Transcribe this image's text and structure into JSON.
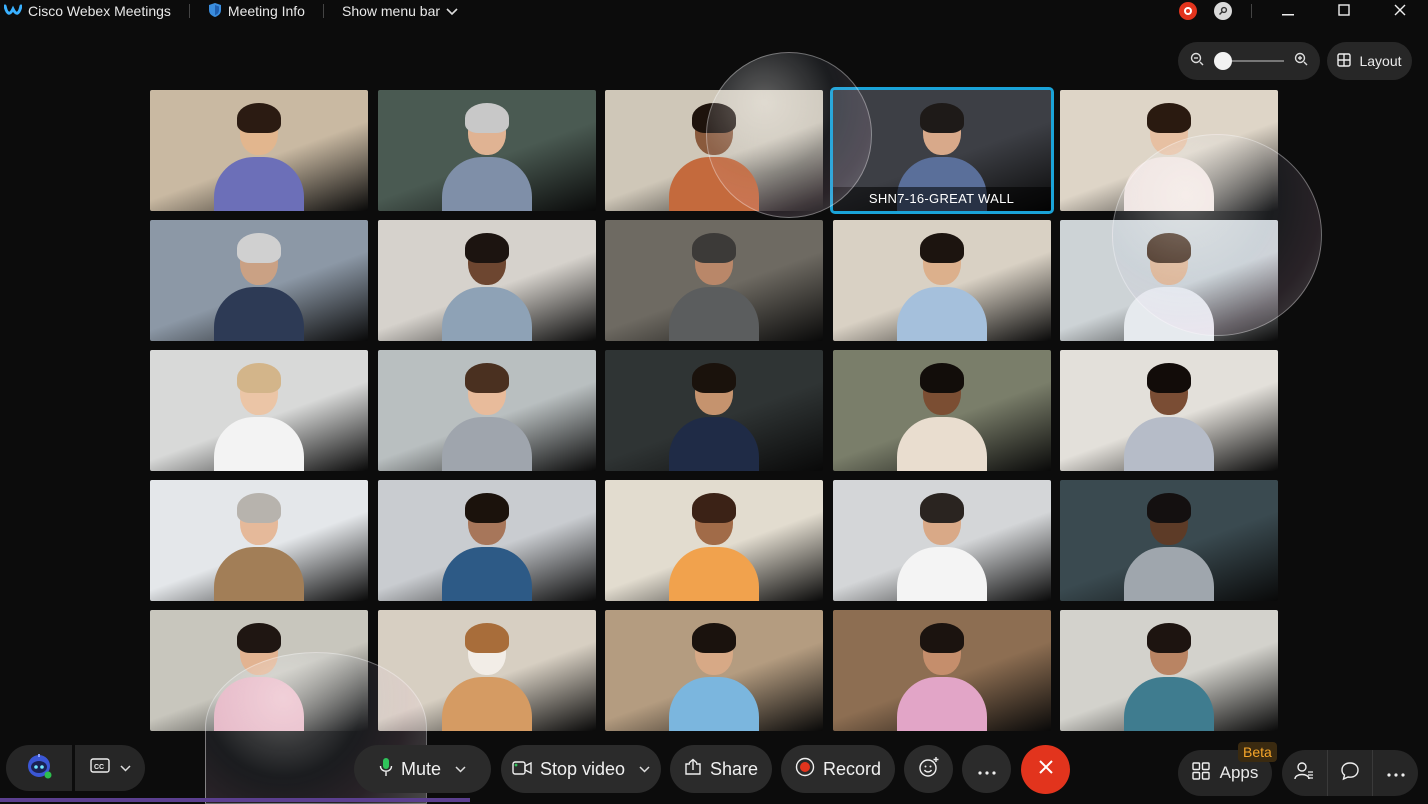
{
  "titlebar": {
    "app_name": "Cisco Webex Meetings",
    "meeting_info": "Meeting Info",
    "show_menu_bar": "Show menu bar"
  },
  "top_controls": {
    "layout_label": "Layout",
    "zoom_level": 0.0
  },
  "tiles": [
    {
      "scene": "#c9b9a2",
      "shirt": "#6c6fb8",
      "skin": "#e2b68e",
      "hair": "#2b1b12"
    },
    {
      "scene": "#4a5a52",
      "shirt": "#7f8fa8",
      "skin": "#e0b393",
      "hair": "#c8c8c8"
    },
    {
      "scene": "#cfc7b8",
      "shirt": "#c46a3d",
      "skin": "#8a5a3c",
      "hair": "#1e130c"
    },
    {
      "scene": "#3d3f45",
      "shirt": "#5a6f9a",
      "skin": "#d8a98a",
      "hair": "#1e1a18",
      "label": "SHN7-16-GREAT WALL",
      "active": true
    },
    {
      "scene": "#ded5c7",
      "shirt": "#f1e4df",
      "skin": "#e7c0a2",
      "hair": "#2a1a10"
    },
    {
      "scene": "#8c98a6",
      "shirt": "#2d3a55",
      "skin": "#caa184",
      "hair": "#d0d0d0"
    },
    {
      "scene": "#d6d2cc",
      "shirt": "#8ea2b6",
      "skin": "#6d4630",
      "hair": "#1c1410"
    },
    {
      "scene": "#6e6a62",
      "shirt": "#5b5d5e",
      "skin": "#b98769",
      "hair": "#3c3a38"
    },
    {
      "scene": "#d9d1c4",
      "shirt": "#a5c0dc",
      "skin": "#dcb08c",
      "hair": "#1c140f"
    },
    {
      "scene": "#cdd3d6",
      "shirt": "#e6eaee",
      "skin": "#e0b796",
      "hair": "#4a3221"
    },
    {
      "scene": "#d8d9d8",
      "shirt": "#f3f3f3",
      "skin": "#ebc5a6",
      "hair": "#d3b58a"
    },
    {
      "scene": "#b9bfc0",
      "shirt": "#9fa5ad",
      "skin": "#e8bb9b",
      "hair": "#4a3020"
    },
    {
      "scene": "#2f3434",
      "shirt": "#1f2b46",
      "skin": "#c5936e",
      "hair": "#1a120c"
    },
    {
      "scene": "#7a7e6a",
      "shirt": "#e9ddcf",
      "skin": "#7b4e33",
      "hair": "#120d0a"
    },
    {
      "scene": "#e3e0da",
      "shirt": "#b6bcc8",
      "skin": "#7a4d34",
      "hair": "#120c09"
    },
    {
      "scene": "#e4e7ea",
      "shirt": "#a27e57",
      "skin": "#e5b99a",
      "hair": "#b7b3ad"
    },
    {
      "scene": "#c9ccd0",
      "shirt": "#2d5a86",
      "skin": "#a7765a",
      "hair": "#1b120c"
    },
    {
      "scene": "#e2dccf",
      "shirt": "#f1a24d",
      "skin": "#a16b48",
      "hair": "#3b2216"
    },
    {
      "scene": "#d4d6d8",
      "shirt": "#f4f4f4",
      "skin": "#d9a987",
      "hair": "#2a2420"
    },
    {
      "scene": "#3a4a50",
      "shirt": "#9fa6ad",
      "skin": "#5d3b27",
      "hair": "#141010"
    },
    {
      "scene": "#c8c6bd",
      "shirt": "#e9b7c4",
      "skin": "#e2b391",
      "hair": "#1f1612"
    },
    {
      "scene": "#d7cfc2",
      "shirt": "#d59b63",
      "skin": "#f2ede7",
      "hair": "#a86d3a"
    },
    {
      "scene": "#b49c80",
      "shirt": "#7bb6de",
      "skin": "#d7a986",
      "hair": "#1a120d"
    },
    {
      "scene": "#8d6e52",
      "shirt": "#e2a5c7",
      "skin": "#c58e6c",
      "hair": "#1b130f"
    },
    {
      "scene": "#d3d2cc",
      "shirt": "#3f7c8f",
      "skin": "#b98463",
      "hair": "#1d1410"
    }
  ],
  "toolbar": {
    "mute_label": "Mute",
    "stop_video_label": "Stop video",
    "share_label": "Share",
    "record_label": "Record",
    "apps_label": "Apps",
    "beta_label": "Beta"
  },
  "colors": {
    "accent_active_tile": "#1aa3d8",
    "end_call": "#e2341d",
    "record_dot": "#e2341d",
    "beta_text": "#f6a62a"
  }
}
